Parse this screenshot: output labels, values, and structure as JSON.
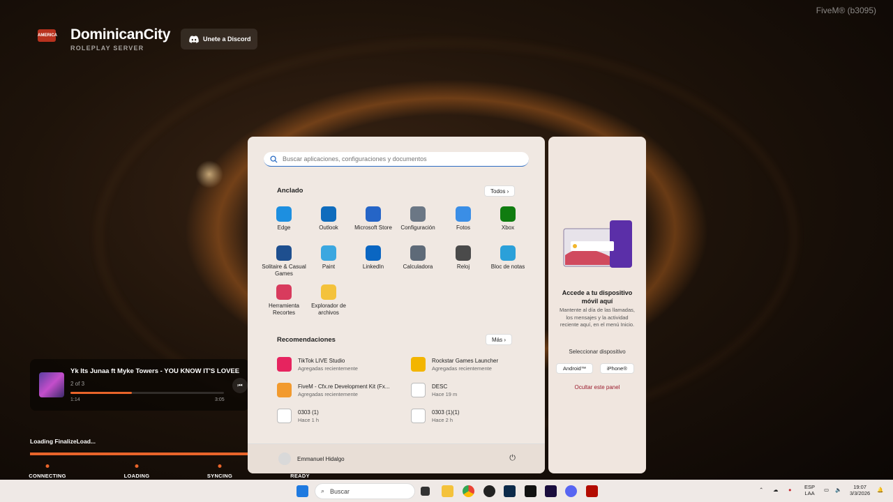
{
  "app": {
    "version": "FiveM® (b3095)",
    "logo_text": "AMERICA"
  },
  "brand": {
    "title": "DominicanCity",
    "subtitle": "ROLEPLAY SERVER"
  },
  "discord": {
    "label": "Unete a Discord"
  },
  "music": {
    "title": "Yk Its Junaa ft Myke Towers - YOU KNOW IT'S LOVEE",
    "index": "2 of 3",
    "elapsed": "1:14",
    "total": "3:05",
    "progress": 0.4
  },
  "loading": {
    "text": "Loading FinalizeLoad...",
    "progress": 1.0,
    "stages": [
      "CONNECTING",
      "LOADING",
      "SYNCING",
      "READY"
    ]
  },
  "start_menu": {
    "search_placeholder": "Buscar aplicaciones, configuraciones y documentos",
    "pinned_title": "Anclado",
    "all_label": "Todos",
    "pinned": [
      {
        "label": "Edge",
        "icon": "edge-icon",
        "color": "#1d8fe0"
      },
      {
        "label": "Outlook",
        "icon": "outlook-icon",
        "color": "#0f6cbd"
      },
      {
        "label": "Microsoft Store",
        "icon": "store-icon",
        "color": "#2565c7"
      },
      {
        "label": "Configuración",
        "icon": "gear-icon",
        "color": "#6b7785"
      },
      {
        "label": "Fotos",
        "icon": "photos-icon",
        "color": "#3a8ee6"
      },
      {
        "label": "Xbox",
        "icon": "xbox-icon",
        "color": "#107c10"
      },
      {
        "label": "Solitaire & Casual Games",
        "icon": "solitaire-icon",
        "color": "#1e4f8f"
      },
      {
        "label": "Paint",
        "icon": "paint-icon",
        "color": "#3ba7e0"
      },
      {
        "label": "LinkedIn",
        "icon": "linkedin-icon",
        "color": "#0a66c2"
      },
      {
        "label": "Calculadora",
        "icon": "calculator-icon",
        "color": "#5e6a78"
      },
      {
        "label": "Reloj",
        "icon": "clock-icon",
        "color": "#4a4a4a"
      },
      {
        "label": "Bloc de notas",
        "icon": "notepad-icon",
        "color": "#2ba0d9"
      },
      {
        "label": "Herramienta Recortes",
        "icon": "snipping-icon",
        "color": "#d83b5d"
      },
      {
        "label": "Explorador de archivos",
        "icon": "folder-icon",
        "color": "#f4c23b"
      }
    ],
    "recommended_title": "Recomendaciones",
    "more_label": "Más",
    "recommended": [
      {
        "name": "TikTok LIVE Studio",
        "sub": "Agregadas recientemente",
        "icon": "tiktok-icon",
        "color": "#e6245f"
      },
      {
        "name": "Rockstar Games Launcher",
        "sub": "Agregadas recientemente",
        "icon": "rockstar-icon",
        "color": "#f3b500"
      },
      {
        "name": "FiveM - Cfx.re Development Kit (Fx...",
        "sub": "Agregadas recientemente",
        "icon": "fivem-icon",
        "color": "#f29a2e"
      },
      {
        "name": "DESC",
        "sub": "Hace 19 m",
        "icon": "file-icon",
        "color": "#ffffff"
      },
      {
        "name": "0303 (1)",
        "sub": "Hace 1 h",
        "icon": "video-icon",
        "color": "#ffffff"
      },
      {
        "name": "0303 (1)(1)",
        "sub": "Hace 2 h",
        "icon": "video-icon",
        "color": "#ffffff"
      }
    ],
    "user": "Emmanuel Hidalgo"
  },
  "side_panel": {
    "heading": "Accede a tu dispositivo móvil aquí",
    "body": "Mantente al día de las llamadas, los mensajes y la actividad reciente aquí, en el menú Inicio.",
    "select_label": "Seleccionar dispositivo",
    "android": "Android™",
    "iphone": "iPhone®",
    "hide": "Ocultar este panel"
  },
  "taskbar": {
    "search": "Buscar",
    "lang1": "ESP",
    "lang2": "LAA",
    "time": "19:07",
    "date": "3/3/2026"
  }
}
